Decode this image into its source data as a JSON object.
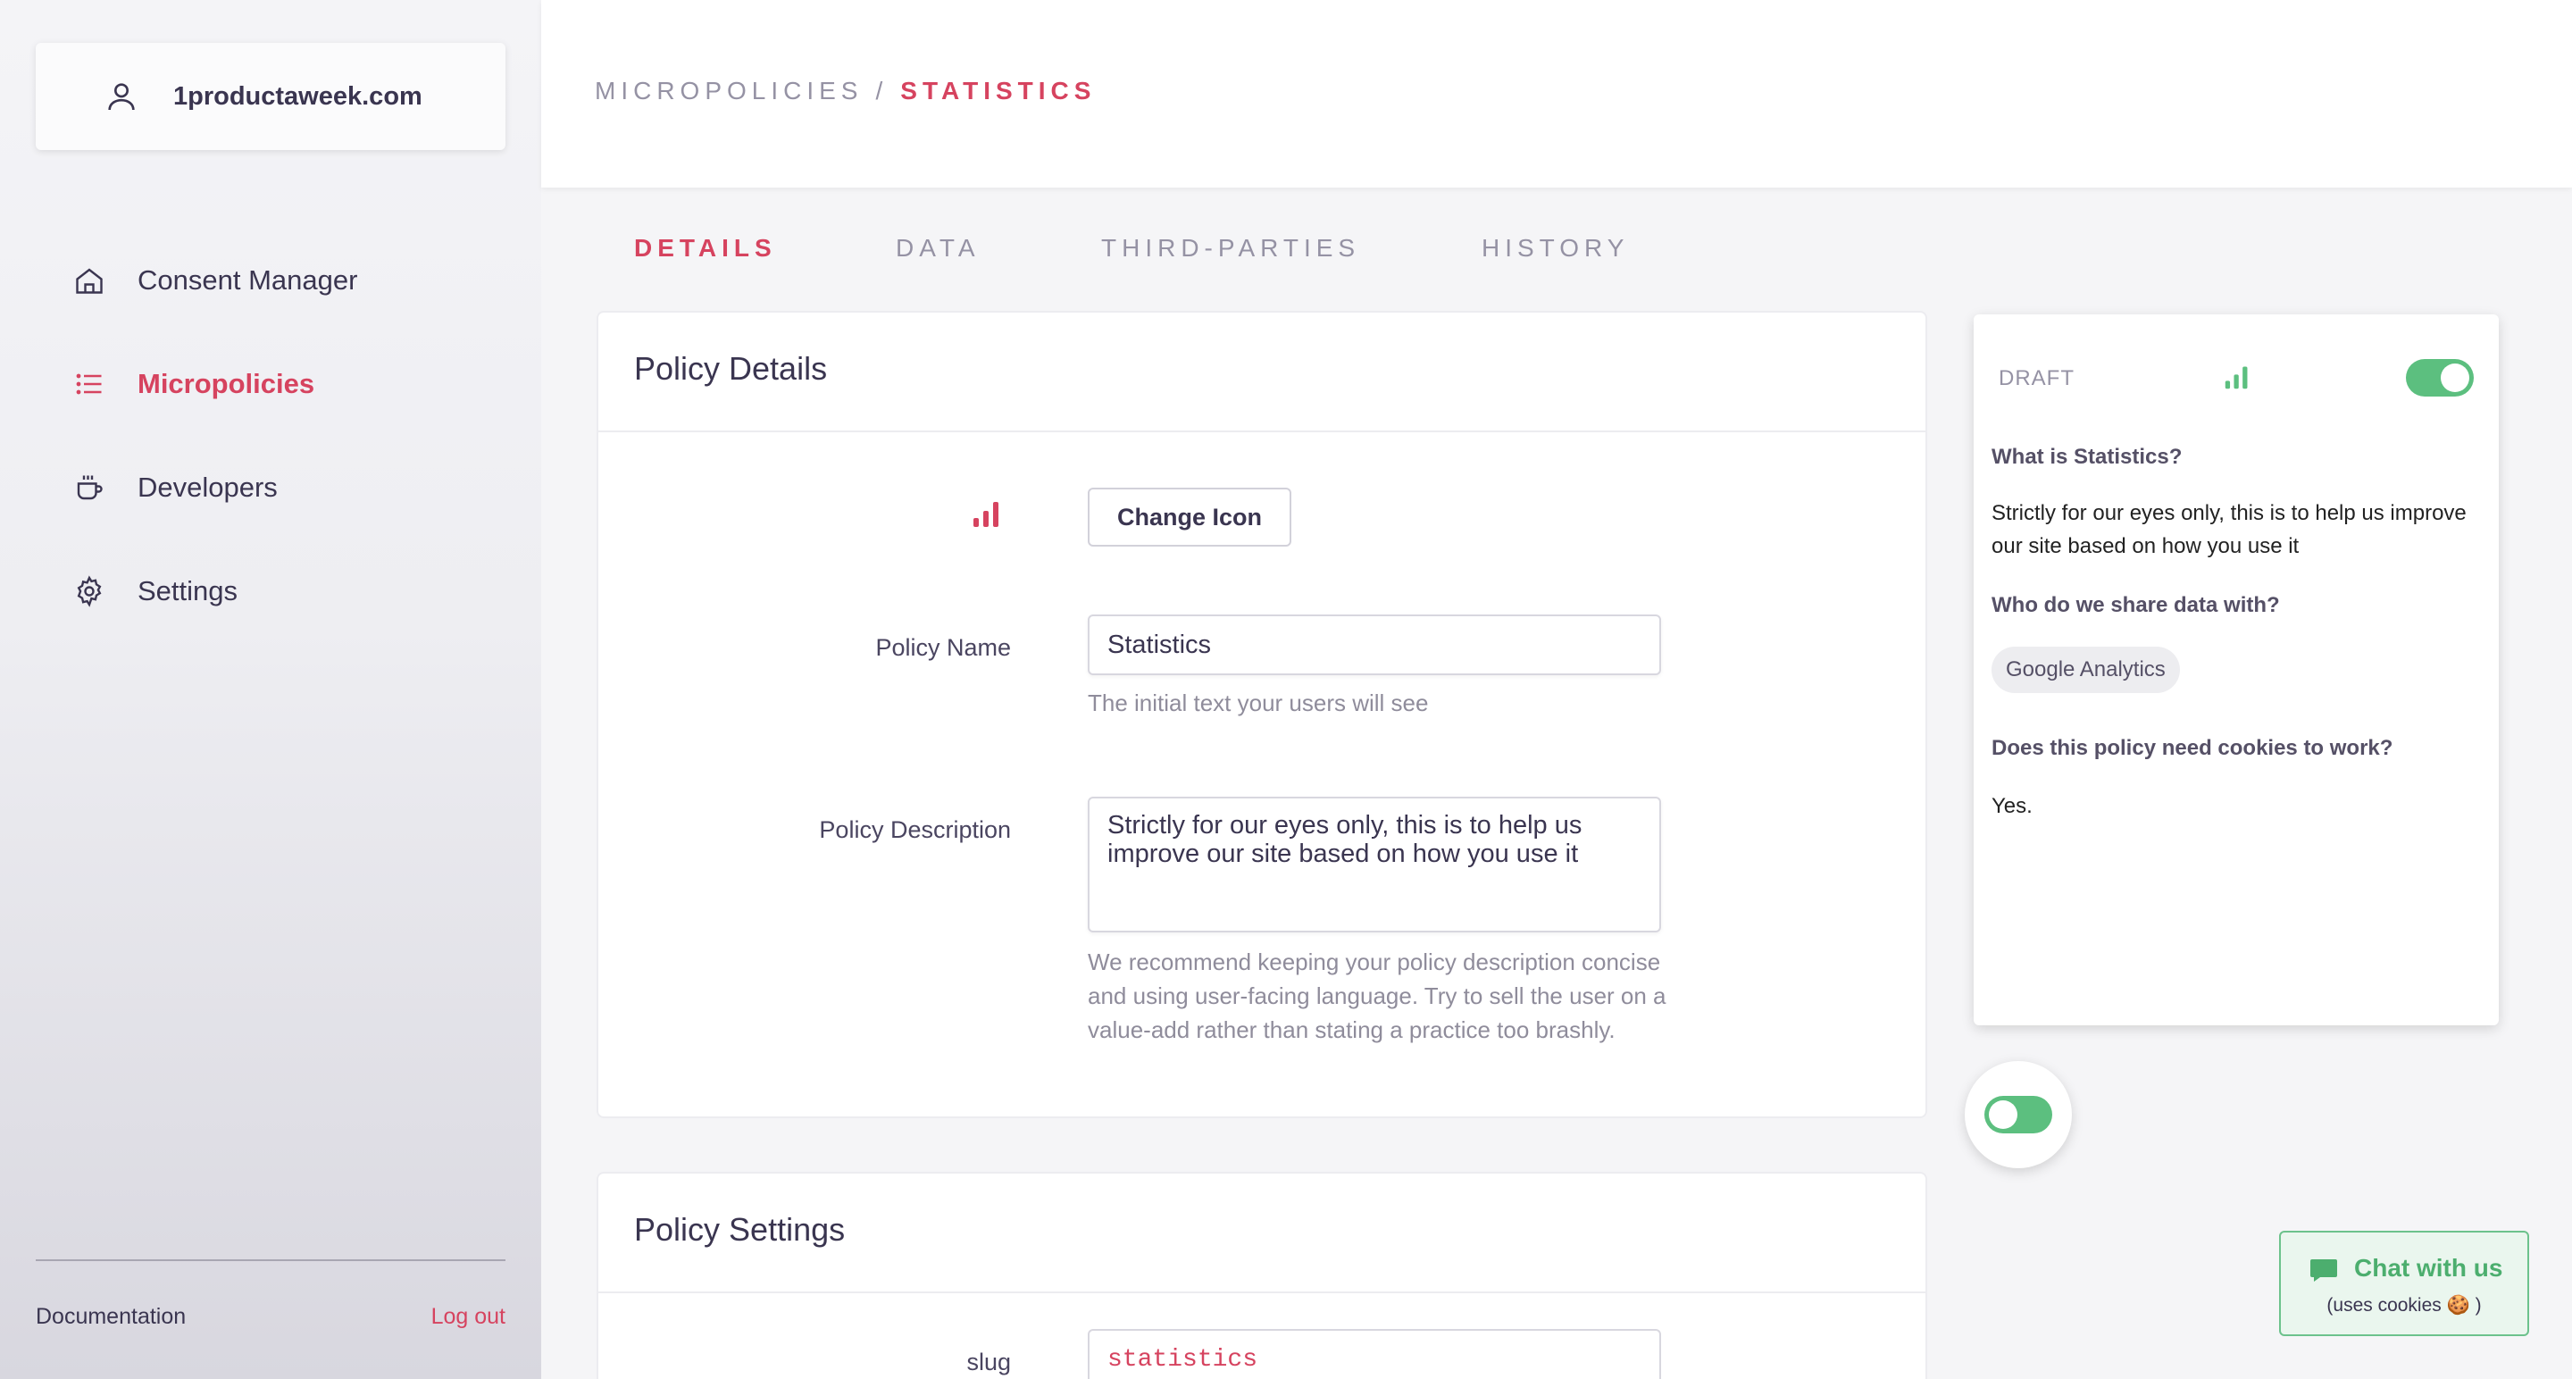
{
  "account": {
    "name": "1productaweek.com"
  },
  "nav": [
    {
      "label": "Consent Manager",
      "icon": "home-icon"
    },
    {
      "label": "Micropolicies",
      "icon": "list-icon",
      "active": true
    },
    {
      "label": "Developers",
      "icon": "coffee-cup-icon"
    },
    {
      "label": "Settings",
      "icon": "gear-icon"
    }
  ],
  "footer": {
    "documentation": "Documentation",
    "logout": "Log out"
  },
  "breadcrumb": {
    "parent": "MICROPOLICIES",
    "separator": "/",
    "current": "STATISTICS"
  },
  "tabs": [
    {
      "label": "DETAILS",
      "active": true
    },
    {
      "label": "DATA"
    },
    {
      "label": "THIRD-PARTIES"
    },
    {
      "label": "HISTORY"
    }
  ],
  "policy_details": {
    "title": "Policy Details",
    "change_icon_label": "Change Icon",
    "name_label": "Policy Name",
    "name_value": "Statistics",
    "name_help": "The initial text your users will see",
    "description_label": "Policy Description",
    "description_value": "Strictly for our eyes only, this is to help us improve our site based on how you use it",
    "description_help": "We recommend keeping your policy description concise and using user-facing language. Try to sell the user on a value-add rather than stating a practice too brashly."
  },
  "policy_settings": {
    "title": "Policy Settings",
    "slug_label": "slug",
    "slug_value": "statistics"
  },
  "preview": {
    "status": "DRAFT",
    "enabled": true,
    "what_question": "What is Statistics?",
    "what_answer": "Strictly for our eyes only, this is to help us improve our site based on how you use it",
    "share_question": "Who do we share data with?",
    "share_chip": "Google Analytics",
    "cookies_question": "Does this policy need cookies to work?",
    "cookies_answer": "Yes."
  },
  "floating_toggle": {
    "enabled": false
  },
  "chat": {
    "title": "Chat with us",
    "subtitle": "(uses cookies 🍪 )"
  },
  "colors": {
    "accent": "#d6435f",
    "success": "#5cbf7f",
    "text": "#3a3550",
    "muted": "#9592a4"
  }
}
